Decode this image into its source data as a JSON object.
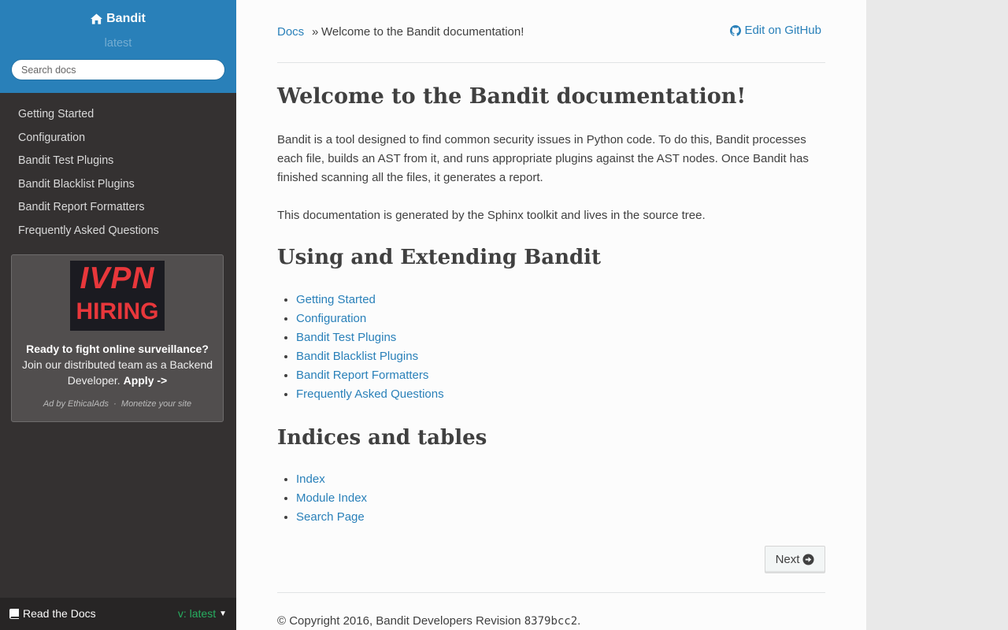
{
  "sidebar": {
    "project_name": "Bandit",
    "version": "latest",
    "search_placeholder": "Search docs",
    "nav": [
      {
        "label": "Getting Started"
      },
      {
        "label": "Configuration"
      },
      {
        "label": "Bandit Test Plugins"
      },
      {
        "label": "Bandit Blacklist Plugins"
      },
      {
        "label": "Bandit Report Formatters"
      },
      {
        "label": "Frequently Asked Questions"
      }
    ],
    "ad": {
      "logo_text": "IVPN",
      "logo_sub": "HIRING",
      "headline": "Ready to fight online surveillance?",
      "body": "Join our distributed team as a Backend Developer.",
      "cta": "Apply ->",
      "ad_by": "Ad by EthicalAds",
      "separator": "·",
      "monetize": "Monetize your site"
    },
    "rtd": {
      "label": "Read the Docs",
      "version_label": "v: latest"
    }
  },
  "breadcrumbs": {
    "root": "Docs",
    "separator": "»",
    "current": "Welcome to the Bandit documentation!",
    "edit_link": "Edit on GitHub"
  },
  "main": {
    "title": "Welcome to the Bandit documentation!",
    "paragraph1": "Bandit is a tool designed to find common security issues in Python code. To do this, Bandit processes each file, builds an AST from it, and runs appropriate plugins against the AST nodes. Once Bandit has finished scanning all the files, it generates a report.",
    "paragraph2": "This documentation is generated by the Sphinx toolkit and lives in the source tree.",
    "section1": {
      "heading": "Using and Extending Bandit",
      "links": [
        "Getting Started",
        "Configuration",
        "Bandit Test Plugins",
        "Bandit Blacklist Plugins",
        "Bandit Report Formatters",
        "Frequently Asked Questions"
      ]
    },
    "section2": {
      "heading": "Indices and tables",
      "links": [
        "Index",
        "Module Index",
        "Search Page"
      ]
    },
    "next_label": "Next"
  },
  "footer": {
    "copyright": "© Copyright 2016, Bandit Developers Revision",
    "revision": "8379bcc2",
    "end": "."
  },
  "colors": {
    "accent": "#2980b9",
    "sidebar_bg": "#343131",
    "version_green": "#27ae60",
    "ad_red": "#e8373b"
  }
}
